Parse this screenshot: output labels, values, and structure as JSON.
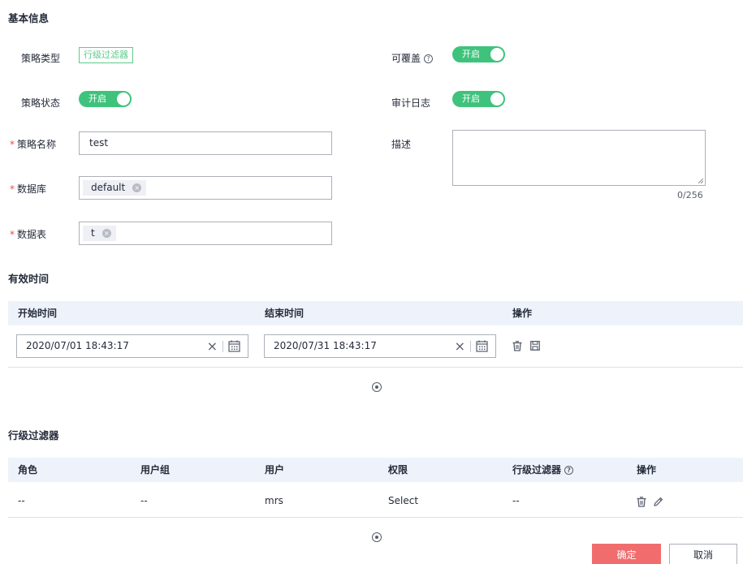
{
  "basic": {
    "title": "基本信息",
    "policy_type_label": "策略类型",
    "policy_type_value": "行级过滤器",
    "overridable_label": "可覆盖",
    "overridable_switch": "开启",
    "policy_status_label": "策略状态",
    "policy_status_switch": "开启",
    "audit_log_label": "审计日志",
    "audit_log_switch": "开启",
    "policy_name_label": "策略名称",
    "policy_name_value": "test",
    "description_label": "描述",
    "description_counter": "0/256",
    "database_label": "数据库",
    "database_chip": "default",
    "table_label": "数据表",
    "table_chip": "t"
  },
  "validity": {
    "title": "有效时间",
    "columns": [
      "开始时间",
      "结束时间",
      "操作"
    ],
    "rows": [
      {
        "start": "2020/07/01 18:43:17",
        "end": "2020/07/31 18:43:17"
      }
    ]
  },
  "row_filter": {
    "title": "行级过滤器",
    "columns": [
      "角色",
      "用户组",
      "用户",
      "权限",
      "行级过滤器",
      "操作"
    ],
    "rows": [
      {
        "role": "--",
        "group": "--",
        "user": "mrs",
        "permission": "Select",
        "filter": "--"
      }
    ]
  },
  "footer": {
    "confirm": "确定",
    "cancel": "取消"
  },
  "colors": {
    "switch_on": "#3fc37c",
    "tag": "#5dcb8a",
    "required": "#e84e40",
    "primary_button": "#f16d6d",
    "table_header_bg": "#eef3fb"
  }
}
